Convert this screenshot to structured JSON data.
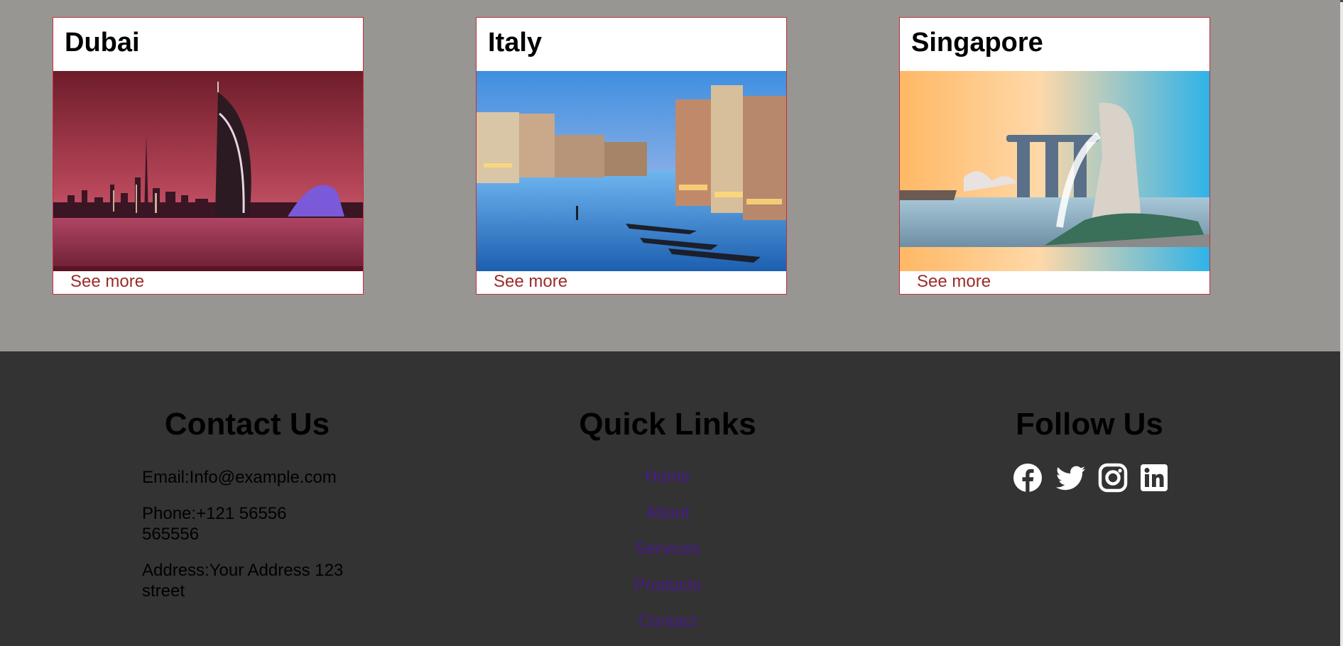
{
  "cards": [
    {
      "title": "Dubai",
      "link": "See more",
      "image": "dubai-skyline-photo"
    },
    {
      "title": "Italy",
      "link": "See more",
      "image": "venice-canal-photo"
    },
    {
      "title": "Singapore",
      "link": "See more",
      "image": "singapore-merlion-photo"
    }
  ],
  "footer": {
    "contact": {
      "title": "Contact Us",
      "email": "Email:Info@example.com",
      "phone_line1": "Phone:+121 56556",
      "phone_line2": "565556",
      "address_line1": "Address:Your Address 123",
      "address_line2": "street"
    },
    "quick_links": {
      "title": "Quick Links",
      "links": [
        "Home",
        "About",
        "Services",
        "Products",
        "Contact"
      ]
    },
    "follow": {
      "title": "Follow Us",
      "icons": [
        "facebook-icon",
        "twitter-icon",
        "instagram-icon",
        "linkedin-icon"
      ]
    }
  },
  "colors": {
    "page_background": "#979693",
    "footer_background": "#333333",
    "card_border": "#c0303a",
    "see_more": "#9b2a2a",
    "quick_link": "#4a1a8c"
  }
}
